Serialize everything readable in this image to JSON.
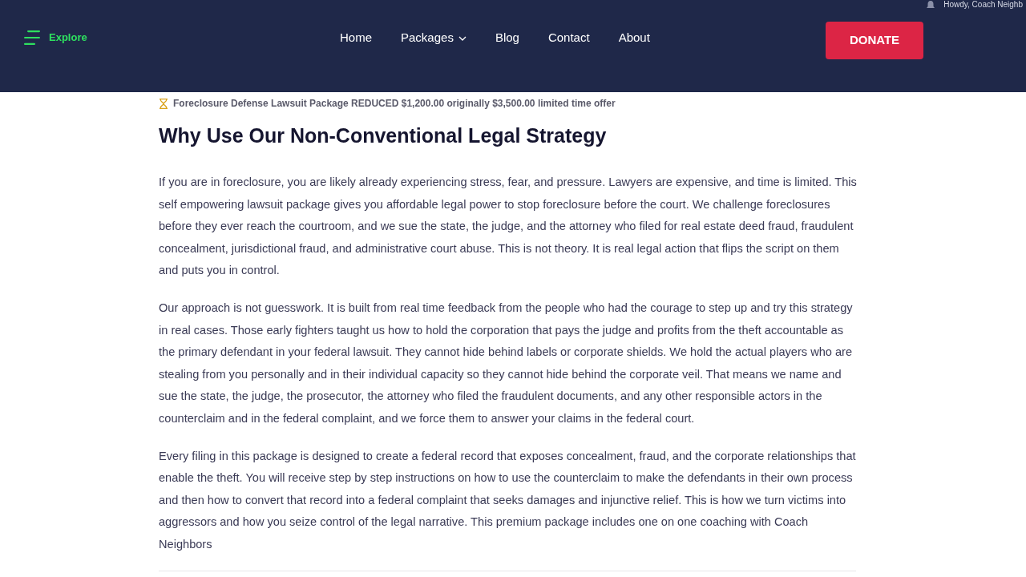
{
  "admin_bar": {
    "greeting": "Howdy, Coach Neighb"
  },
  "header": {
    "explore": "Explore",
    "nav": [
      {
        "label": "Home",
        "dropdown": false
      },
      {
        "label": "Packages",
        "dropdown": true
      },
      {
        "label": "Blog",
        "dropdown": false
      },
      {
        "label": "Contact",
        "dropdown": false
      },
      {
        "label": "About",
        "dropdown": false
      }
    ],
    "donate_button": "DONATE"
  },
  "announcement": {
    "text": "Foreclosure Defense Lawsuit Package REDUCED $1,200.00 originally $3,500.00 limited time offer"
  },
  "article": {
    "heading": "Why Use Our Non-Conventional Legal Strategy",
    "paragraphs": [
      "If you are in foreclosure, you are likely already experiencing stress, fear, and pressure. Lawyers are expensive, and time is limited. This self empowering lawsuit package gives you affordable legal power to stop foreclosure before the court. We challenge foreclosures before they ever reach the courtroom, and we sue the state, the judge, and the attorney who filed for real estate deed fraud, fraudulent concealment, jurisdictional fraud, and administrative court abuse. This is not theory. It is real legal action that flips the script on them and puts you in control.",
      "Our approach is not guesswork. It is built from real time feedback from the people who had the courage to step up and try this strategy in real cases. Those early fighters taught us how to hold the corporation that pays the judge and profits from the theft accountable as the primary defendant in your federal lawsuit. They cannot hide behind labels or corporate shields. We hold the actual players who are stealing from you personally and in their individual capacity so they cannot hide behind the corporate veil. That means we name and sue the state, the judge, the prosecutor, the attorney who filed the fraudulent documents, and any other responsible actors in the counterclaim and in the federal complaint, and we force them to answer your claims in the federal court.",
      "Every filing in this package is designed to create a federal record that exposes concealment, fraud, and the corporate relationships that enable the theft. You will receive step by step instructions on how to use the counterclaim to make the defendants in their own process and then how to convert that record into a federal complaint that seeks damages and injunctive relief. This is how we turn victims into aggressors and how you seize control of the legal narrative. This premium package includes one on one coaching with Coach Neighbors"
    ]
  }
}
